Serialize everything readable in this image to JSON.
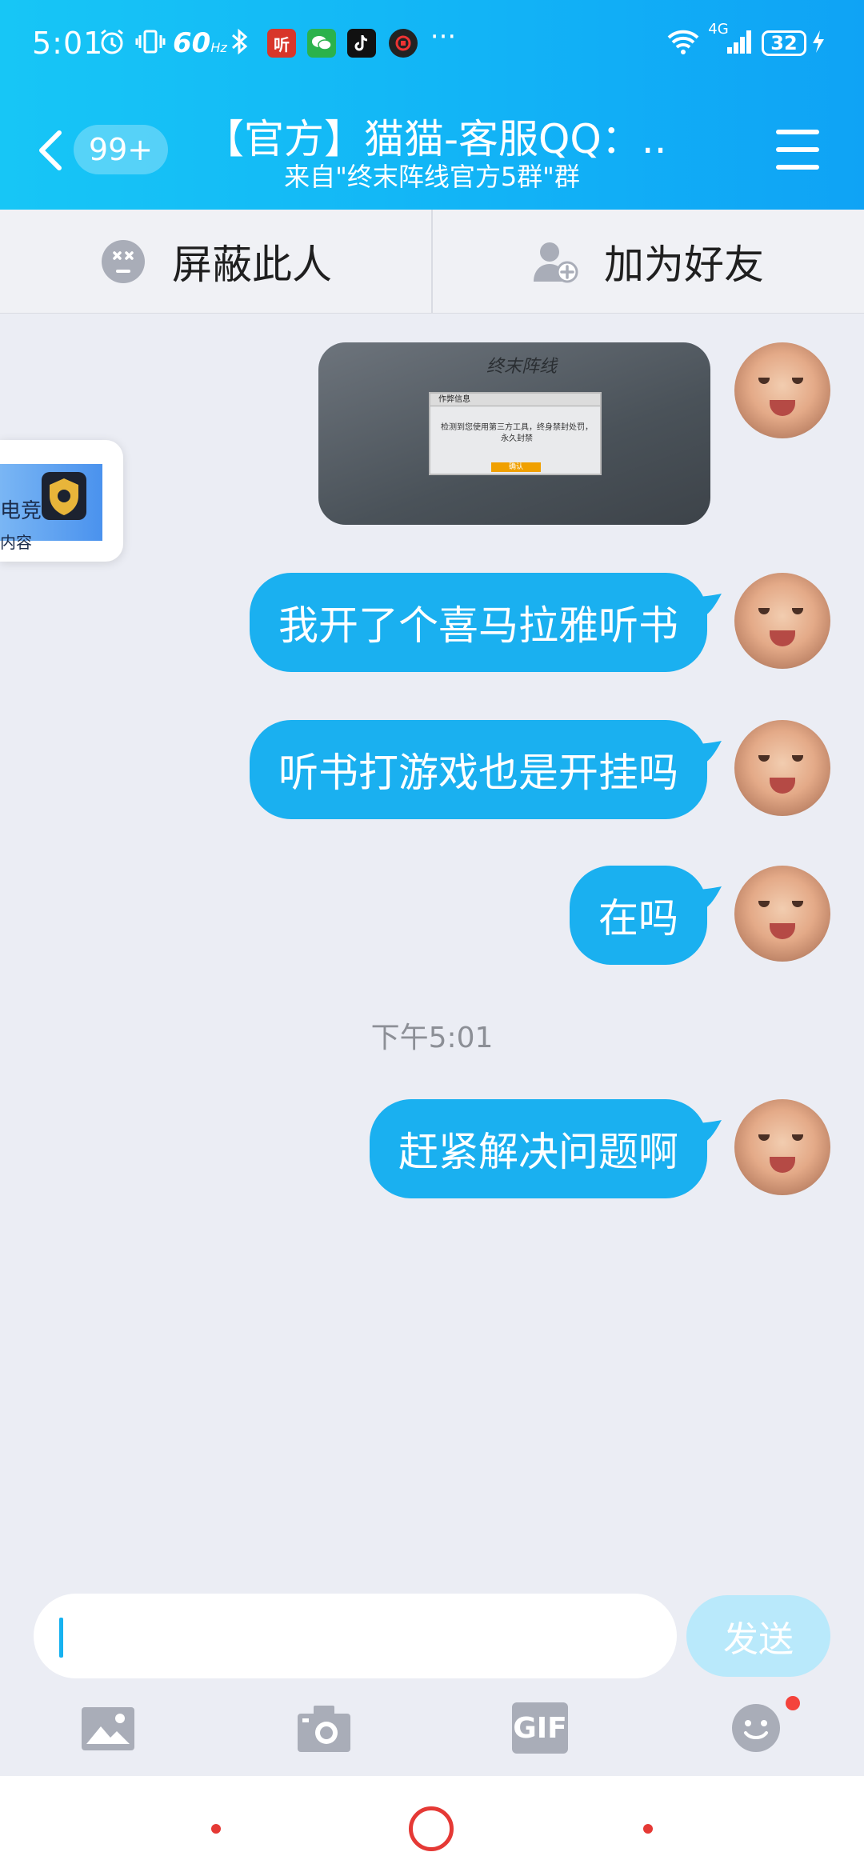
{
  "status_bar": {
    "time": "5:01",
    "refresh_rate": "60",
    "refresh_unit": "Hz",
    "app_icon_listen": "听",
    "more": "···",
    "network": "4G",
    "battery": "32"
  },
  "nav": {
    "unread_badge": "99+",
    "title": "【官方】猫猫-客服QQ：...",
    "subtitle": "来自\"终末阵线官方5群\"群"
  },
  "actions": {
    "block_label": "屏蔽此人",
    "add_friend_label": "加为好友"
  },
  "floating_card": {
    "line1": "电竞",
    "line2": "内容"
  },
  "image_message": {
    "dialog_title": "作弊信息",
    "dialog_text": "检测到您使用第三方工具，终身禁封处罚，永久封禁",
    "dialog_button": "确认"
  },
  "messages": [
    {
      "text": "我开了个喜马拉雅听书"
    },
    {
      "text": "听书打游戏也是开挂吗"
    },
    {
      "text": "在吗"
    },
    {
      "text": "赶紧解决问题啊"
    }
  ],
  "timestamp": "下午5:01",
  "input": {
    "value": "",
    "send_label": "发送"
  },
  "toolbar": {
    "gif_label": "GIF"
  },
  "colors": {
    "header_gradient_start": "#17c6f6",
    "header_gradient_end": "#0fa3f5",
    "bubble": "#1ab0f0",
    "send_disabled": "#b9e9fb",
    "background": "#ebedf4",
    "notification_dot": "#f4433c"
  }
}
